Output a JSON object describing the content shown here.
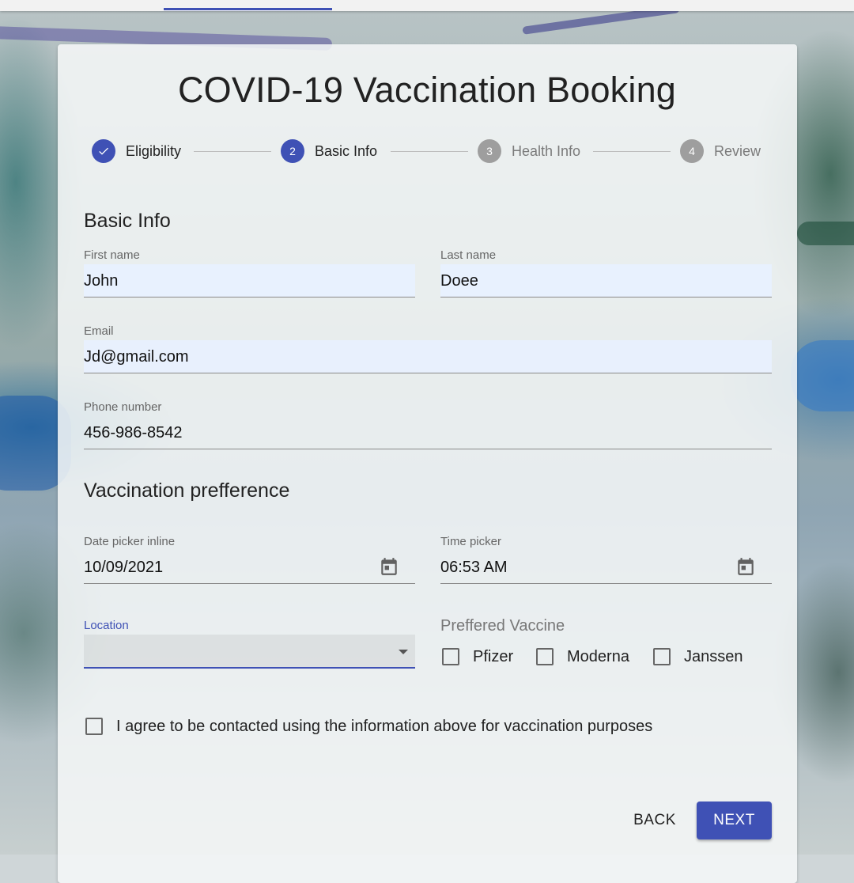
{
  "title": "COVID-19 Vaccination Booking",
  "stepper": [
    {
      "label": "Eligibility",
      "number": "",
      "state": "done"
    },
    {
      "label": "Basic Info",
      "number": "2",
      "state": "active"
    },
    {
      "label": "Health Info",
      "number": "3",
      "state": "idle"
    },
    {
      "label": "Review",
      "number": "4",
      "state": "idle"
    }
  ],
  "basic_info": {
    "heading": "Basic Info",
    "first_name": {
      "label": "First name",
      "value": "John"
    },
    "last_name": {
      "label": "Last name",
      "value": "Doee"
    },
    "email": {
      "label": "Email",
      "value": "Jd@gmail.com"
    },
    "phone": {
      "label": "Phone number",
      "value": "456-986-8542"
    }
  },
  "preference": {
    "heading": "Vaccination prefference",
    "date": {
      "label": "Date picker inline",
      "value": "10/09/2021"
    },
    "time": {
      "label": "Time picker",
      "value": "06:53 AM"
    },
    "location": {
      "label": "Location",
      "value": ""
    },
    "vaccine": {
      "label": "Preffered Vaccine",
      "options": [
        {
          "label": "Pfizer",
          "checked": false
        },
        {
          "label": "Moderna",
          "checked": false
        },
        {
          "label": "Janssen",
          "checked": false
        }
      ]
    }
  },
  "consent": {
    "label": "I agree to be contacted using the information above for vaccination purposes",
    "checked": false
  },
  "actions": {
    "back": "BACK",
    "next": "NEXT"
  },
  "colors": {
    "primary": "#3f51b5",
    "idle_step": "#9e9e9e",
    "field_fill": "#e8f0fe"
  },
  "icons": {
    "done_step": "check-icon",
    "picker": "calendar-icon",
    "select": "dropdown-arrow-icon"
  }
}
